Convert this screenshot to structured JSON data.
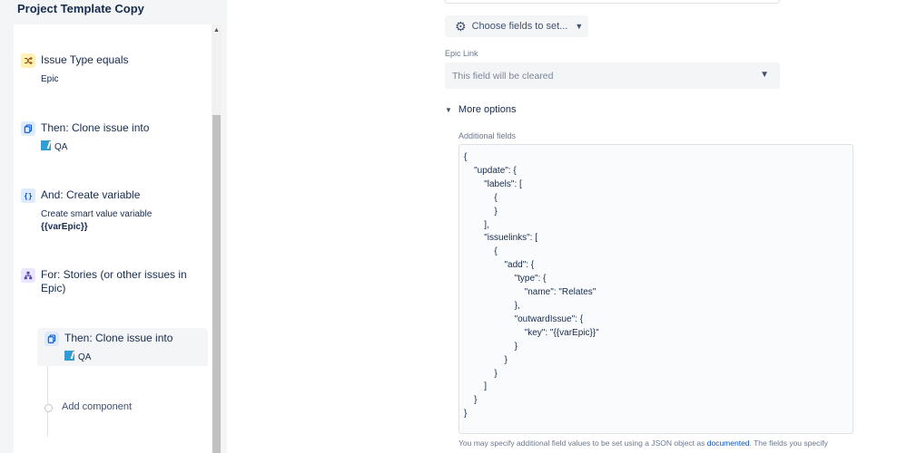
{
  "rule": {
    "title": "Project Template Copy",
    "components": [
      {
        "kind": "condition",
        "icon": "shuffle-icon",
        "title": "Issue Type equals",
        "sub": "Epic"
      },
      {
        "kind": "action",
        "icon": "copy-icon",
        "title": "Then: Clone issue into",
        "project": "QA"
      },
      {
        "kind": "action",
        "icon": "braces-icon",
        "title": "And: Create variable",
        "sub": "Create smart value variable",
        "sub_bold": "{{varEpic}}"
      },
      {
        "kind": "branch",
        "icon": "branch-icon",
        "title": "For: Stories (or other issues in Epic)"
      },
      {
        "kind": "action",
        "icon": "copy-icon",
        "title": "Then: Clone issue into",
        "project": "QA"
      }
    ],
    "add_component": "Add component"
  },
  "config": {
    "choose_fields": "Choose fields to set...",
    "epic_link_label": "Epic Link",
    "epic_link_value": "This field will be cleared",
    "more_options": "More options",
    "additional_fields_label": "Additional fields",
    "json_lines": [
      "{",
      "    \"update\": {",
      "        \"labels\": [",
      "            {",
      "",
      "            }",
      "        ],",
      "        \"issuelinks\": [",
      "            {",
      "                \"add\": {",
      "                    \"type\": {",
      "                        \"name\": \"Relates\"",
      "                    },",
      "                    \"outwardIssue\": {",
      "                        \"key\": \"{{varEpic}}\"",
      "                    }",
      "                }",
      "            }",
      "        ]",
      "    }",
      "}"
    ],
    "help_prefix": "You may specify additional field values to be set using a JSON object as ",
    "help_link": "documented",
    "help_suffix": ". The fields you specify"
  }
}
